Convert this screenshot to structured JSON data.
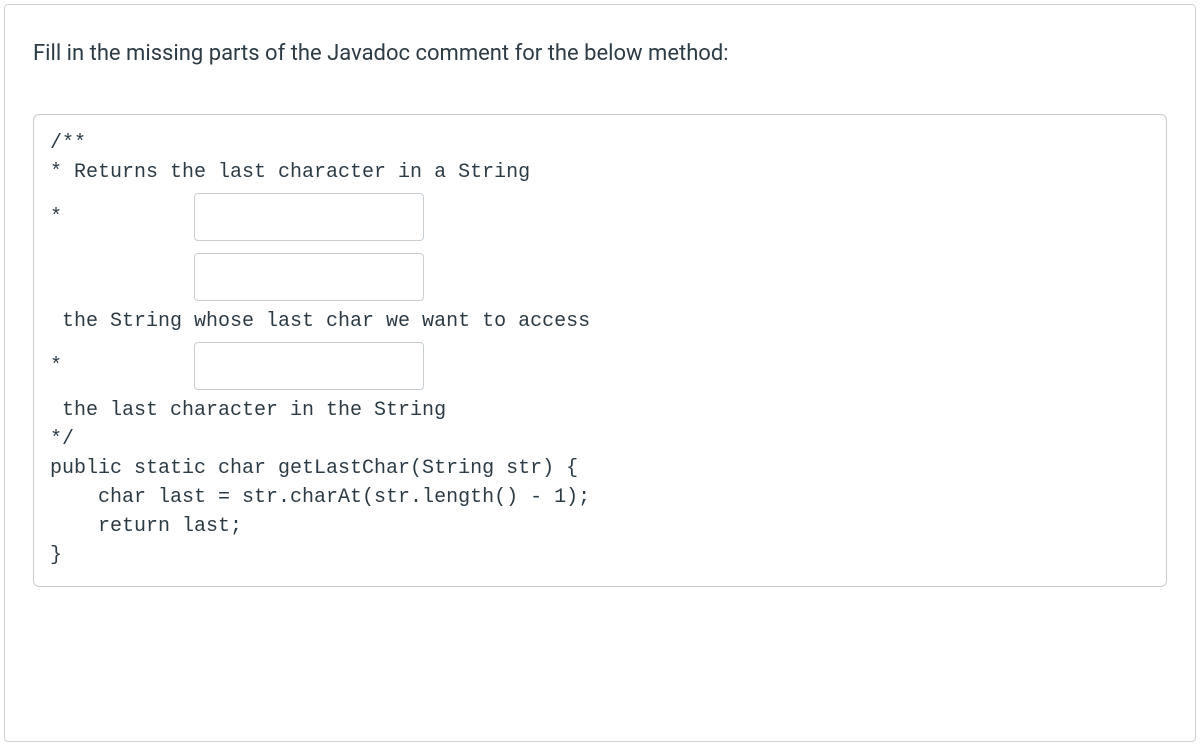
{
  "instruction": "Fill in the missing parts of the Javadoc comment for the below method:",
  "code": {
    "line1": "/**",
    "line2": "* Returns the last character in a String",
    "line3_prefix": "*",
    "blank1_value": "",
    "blank2_value": "",
    "line5": " the String whose last char we want to access",
    "line6_prefix": "*",
    "blank3_value": "",
    "line7": " the last character in the String",
    "line8": "*/",
    "line9": "public static char getLastChar(String str) {",
    "line10": "    char last = str.charAt(str.length() - 1);",
    "line11": "    return last;",
    "line12": "}"
  }
}
